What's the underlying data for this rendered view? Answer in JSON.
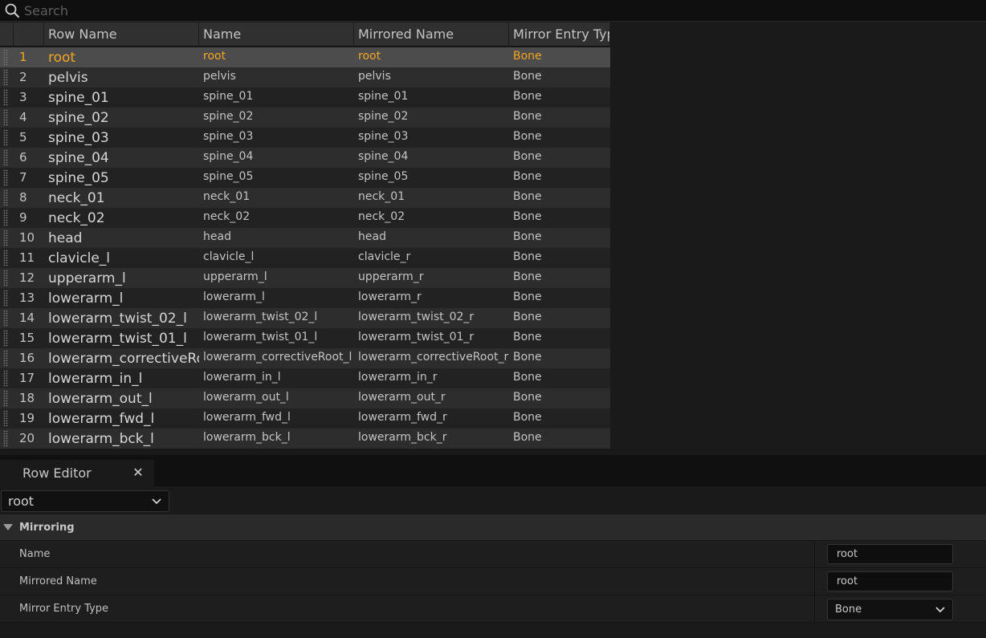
{
  "search": {
    "placeholder": "Search",
    "value": ""
  },
  "table": {
    "columns": [
      "Row Name",
      "Name",
      "Mirrored Name",
      "Mirror Entry Type"
    ],
    "selected_index": 0,
    "rows": [
      {
        "idx": "1",
        "row_name": "root",
        "name": "root",
        "mirrored": "root",
        "type": "Bone"
      },
      {
        "idx": "2",
        "row_name": "pelvis",
        "name": "pelvis",
        "mirrored": "pelvis",
        "type": "Bone"
      },
      {
        "idx": "3",
        "row_name": "spine_01",
        "name": "spine_01",
        "mirrored": "spine_01",
        "type": "Bone"
      },
      {
        "idx": "4",
        "row_name": "spine_02",
        "name": "spine_02",
        "mirrored": "spine_02",
        "type": "Bone"
      },
      {
        "idx": "5",
        "row_name": "spine_03",
        "name": "spine_03",
        "mirrored": "spine_03",
        "type": "Bone"
      },
      {
        "idx": "6",
        "row_name": "spine_04",
        "name": "spine_04",
        "mirrored": "spine_04",
        "type": "Bone"
      },
      {
        "idx": "7",
        "row_name": "spine_05",
        "name": "spine_05",
        "mirrored": "spine_05",
        "type": "Bone"
      },
      {
        "idx": "8",
        "row_name": "neck_01",
        "name": "neck_01",
        "mirrored": "neck_01",
        "type": "Bone"
      },
      {
        "idx": "9",
        "row_name": "neck_02",
        "name": "neck_02",
        "mirrored": "neck_02",
        "type": "Bone"
      },
      {
        "idx": "10",
        "row_name": "head",
        "name": "head",
        "mirrored": "head",
        "type": "Bone"
      },
      {
        "idx": "11",
        "row_name": "clavicle_l",
        "name": "clavicle_l",
        "mirrored": "clavicle_r",
        "type": "Bone"
      },
      {
        "idx": "12",
        "row_name": "upperarm_l",
        "name": "upperarm_l",
        "mirrored": "upperarm_r",
        "type": "Bone"
      },
      {
        "idx": "13",
        "row_name": "lowerarm_l",
        "name": "lowerarm_l",
        "mirrored": "lowerarm_r",
        "type": "Bone"
      },
      {
        "idx": "14",
        "row_name": "lowerarm_twist_02_l",
        "name": "lowerarm_twist_02_l",
        "mirrored": "lowerarm_twist_02_r",
        "type": "Bone"
      },
      {
        "idx": "15",
        "row_name": "lowerarm_twist_01_l",
        "name": "lowerarm_twist_01_l",
        "mirrored": "lowerarm_twist_01_r",
        "type": "Bone"
      },
      {
        "idx": "16",
        "row_name": "lowerarm_correctiveRoot_l",
        "name": "lowerarm_correctiveRoot_l",
        "mirrored": "lowerarm_correctiveRoot_r",
        "type": "Bone"
      },
      {
        "idx": "17",
        "row_name": "lowerarm_in_l",
        "name": "lowerarm_in_l",
        "mirrored": "lowerarm_in_r",
        "type": "Bone"
      },
      {
        "idx": "18",
        "row_name": "lowerarm_out_l",
        "name": "lowerarm_out_l",
        "mirrored": "lowerarm_out_r",
        "type": "Bone"
      },
      {
        "idx": "19",
        "row_name": "lowerarm_fwd_l",
        "name": "lowerarm_fwd_l",
        "mirrored": "lowerarm_fwd_r",
        "type": "Bone"
      },
      {
        "idx": "20",
        "row_name": "lowerarm_bck_l",
        "name": "lowerarm_bck_l",
        "mirrored": "lowerarm_bck_r",
        "type": "Bone"
      }
    ]
  },
  "editor": {
    "tab_label": "Row Editor",
    "close_glyph": "✕",
    "row_selector_value": "root",
    "section_title": "Mirroring",
    "props": {
      "name_label": "Name",
      "name_value": "root",
      "mirrored_label": "Mirrored Name",
      "mirrored_value": "root",
      "type_label": "Mirror Entry Type",
      "type_value": "Bone"
    }
  },
  "colors": {
    "selected_text": "#f5a623",
    "background": "#1a1a1a",
    "row_odd": "#2d2d2d",
    "row_even": "#222222",
    "row_selected": "#4c4c4c"
  },
  "icons": {
    "search": "search-icon",
    "close": "close-icon",
    "dropdown": "chevron-down-icon"
  }
}
